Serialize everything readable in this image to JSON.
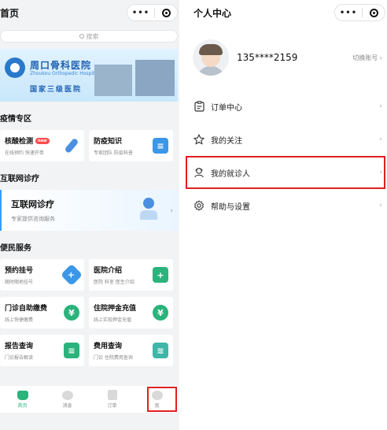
{
  "left": {
    "title": "首页",
    "capsule": {
      "more": "•••"
    },
    "search": {
      "placeholder": "搜索"
    },
    "banner": {
      "name": "周口骨科医院",
      "subname": "Zhoukou Orthopedic Hospital",
      "grade": "国家三级医院"
    },
    "sections": {
      "epidemic": "疫情专区",
      "online": "互联网诊疗",
      "service": "便民服务"
    },
    "epidemic_cards": [
      {
        "title": "核酸检测",
        "badge": "new",
        "sub": "在线预约 快速开单",
        "color": "#4a8fe0",
        "icon": "test-tube-icon"
      },
      {
        "title": "防疫知识",
        "sub": "专家团队 防疫科普",
        "color": "#3b97e8",
        "icon": "book-icon"
      }
    ],
    "online_card": {
      "title": "互联网诊疗",
      "sub": "专家提供咨询服务"
    },
    "service_cards": [
      {
        "title": "预约挂号",
        "sub": "随时随地挂号",
        "color": "#3b97e8",
        "icon": "plus-icon",
        "glyph": "+"
      },
      {
        "title": "医院介绍",
        "sub": "医院 科室 医生介绍",
        "color": "#2ab37a",
        "icon": "hospital-icon",
        "glyph": "+"
      },
      {
        "title": "门诊自助缴费",
        "sub": "线上快捷缴费",
        "color": "#2ab37a",
        "icon": "yen-icon",
        "glyph": "¥"
      },
      {
        "title": "住院押金充值",
        "sub": "线上实现押金充值",
        "color": "#2ab37a",
        "icon": "yen-icon",
        "glyph": "¥"
      },
      {
        "title": "报告查询",
        "sub": "门诊报告解读",
        "color": "#2ab37a",
        "icon": "report-icon",
        "glyph": "≡"
      },
      {
        "title": "费用查询",
        "sub": "门诊 住院费用查询",
        "color": "#3fb6a8",
        "icon": "coins-icon",
        "glyph": "≋"
      }
    ],
    "tabbar": [
      {
        "label": "首页"
      },
      {
        "label": "消息"
      },
      {
        "label": "订单"
      },
      {
        "label": "我"
      }
    ]
  },
  "right": {
    "title": "个人中心",
    "capsule": {
      "more": "•••"
    },
    "phone": "135****2159",
    "switch_account": "切换账号",
    "menu": [
      {
        "label": "订单中心",
        "icon": "order-icon"
      },
      {
        "label": "我的关注",
        "icon": "star-icon"
      },
      {
        "label": "我的就诊人",
        "icon": "patient-icon"
      },
      {
        "label": "帮助与设置",
        "icon": "gear-icon"
      }
    ]
  }
}
